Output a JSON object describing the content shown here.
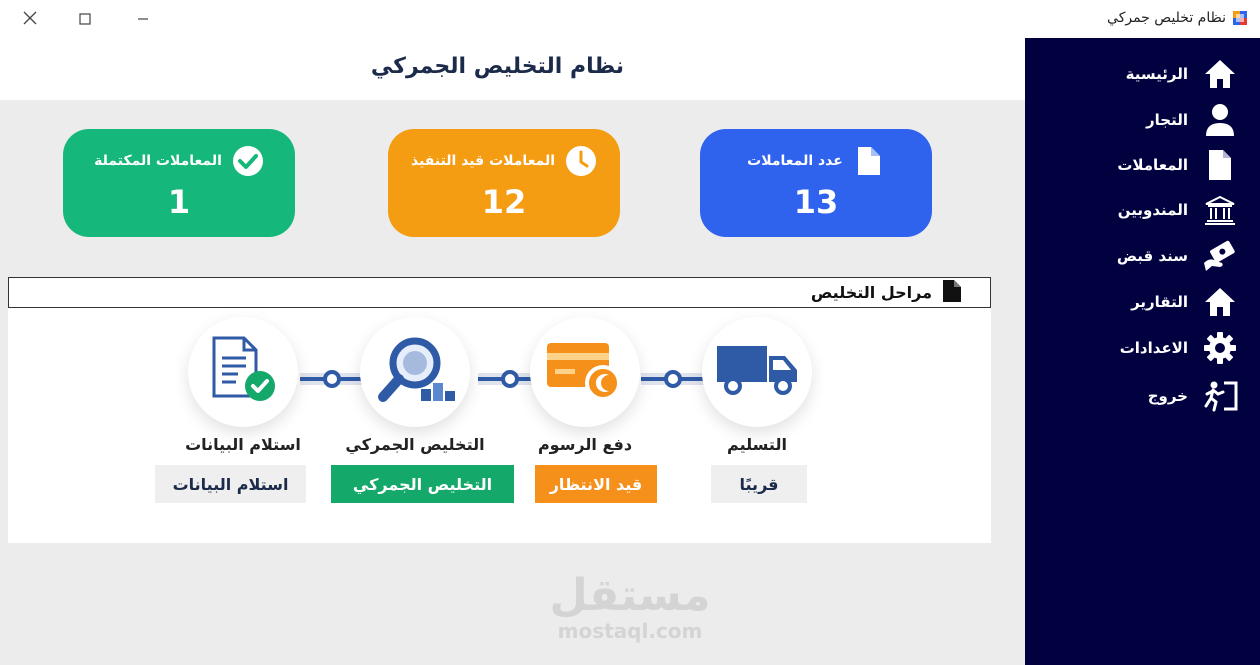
{
  "window": {
    "title": "نظام تخليص جمركي",
    "controls": {
      "close": "✕",
      "maximize": "☐",
      "minimize": "—"
    }
  },
  "sidebar": {
    "items": [
      {
        "label": "الرئيسية",
        "icon": "home-icon"
      },
      {
        "label": "التجار",
        "icon": "user-icon"
      },
      {
        "label": "المعاملات",
        "icon": "document-icon"
      },
      {
        "label": "المندوبين",
        "icon": "bank-icon"
      },
      {
        "label": "سند قبض",
        "icon": "payment-hand-icon"
      },
      {
        "label": "التقارير",
        "icon": "home-icon"
      },
      {
        "label": "الاعدادات",
        "icon": "gear-icon"
      },
      {
        "label": "خروج",
        "icon": "exit-icon"
      }
    ]
  },
  "header": {
    "title": "نظام التخليص الجمركي"
  },
  "cards": [
    {
      "label": "عدد المعاملات",
      "value": "13",
      "icon": "document-icon",
      "color": "#2f63ee"
    },
    {
      "label": "المعاملات قيد التنفيذ",
      "value": "12",
      "icon": "clock-icon",
      "color": "#f49c12"
    },
    {
      "label": "المعاملات المكتملة",
      "value": "1",
      "icon": "check-circle-icon",
      "color": "#15b87a"
    }
  ],
  "stages_panel": {
    "title": "مراحل التخليص",
    "stages": [
      {
        "label": "التسليم",
        "status": "قريبًا",
        "icon": "truck-icon",
        "badge_bg": "#efefef",
        "badge_color": "#1c2b4a"
      },
      {
        "label": "دفع الرسوم",
        "status": "قيد الانتظار",
        "icon": "credit-card-icon",
        "badge_bg": "#f5901a",
        "badge_color": "#ffffff"
      },
      {
        "label": "التخليص الجمركي",
        "status": "التخليص الجمركي",
        "icon": "magnifier-icon",
        "badge_bg": "#14a86b",
        "badge_color": "#ffffff"
      },
      {
        "label": "استلام البيانات",
        "status": "استلام البيانات",
        "icon": "document-check-icon",
        "badge_bg": "#efefef",
        "badge_color": "#1c2b4a"
      }
    ]
  },
  "watermark": {
    "arabic": "مستقل",
    "latin": "mostaql.com"
  },
  "colors": {
    "sidebar_bg": "#010140",
    "main_bg": "#ececec",
    "title": "#1c2b4a"
  }
}
